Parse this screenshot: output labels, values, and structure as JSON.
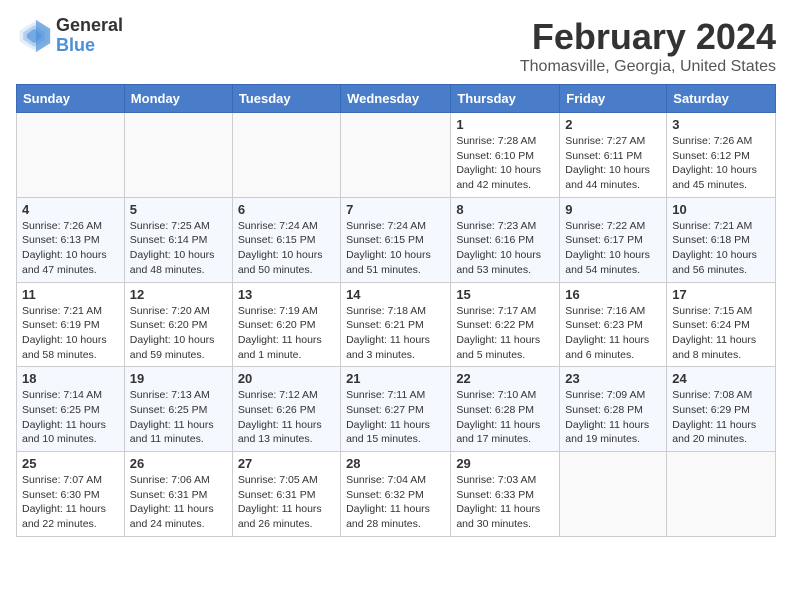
{
  "header": {
    "logo_general": "General",
    "logo_blue": "Blue",
    "month_year": "February 2024",
    "location": "Thomasville, Georgia, United States"
  },
  "days_of_week": [
    "Sunday",
    "Monday",
    "Tuesday",
    "Wednesday",
    "Thursday",
    "Friday",
    "Saturday"
  ],
  "weeks": [
    {
      "days": [
        {
          "num": "",
          "info": ""
        },
        {
          "num": "",
          "info": ""
        },
        {
          "num": "",
          "info": ""
        },
        {
          "num": "",
          "info": ""
        },
        {
          "num": "1",
          "info": "Sunrise: 7:28 AM\nSunset: 6:10 PM\nDaylight: 10 hours\nand 42 minutes."
        },
        {
          "num": "2",
          "info": "Sunrise: 7:27 AM\nSunset: 6:11 PM\nDaylight: 10 hours\nand 44 minutes."
        },
        {
          "num": "3",
          "info": "Sunrise: 7:26 AM\nSunset: 6:12 PM\nDaylight: 10 hours\nand 45 minutes."
        }
      ]
    },
    {
      "days": [
        {
          "num": "4",
          "info": "Sunrise: 7:26 AM\nSunset: 6:13 PM\nDaylight: 10 hours\nand 47 minutes."
        },
        {
          "num": "5",
          "info": "Sunrise: 7:25 AM\nSunset: 6:14 PM\nDaylight: 10 hours\nand 48 minutes."
        },
        {
          "num": "6",
          "info": "Sunrise: 7:24 AM\nSunset: 6:15 PM\nDaylight: 10 hours\nand 50 minutes."
        },
        {
          "num": "7",
          "info": "Sunrise: 7:24 AM\nSunset: 6:15 PM\nDaylight: 10 hours\nand 51 minutes."
        },
        {
          "num": "8",
          "info": "Sunrise: 7:23 AM\nSunset: 6:16 PM\nDaylight: 10 hours\nand 53 minutes."
        },
        {
          "num": "9",
          "info": "Sunrise: 7:22 AM\nSunset: 6:17 PM\nDaylight: 10 hours\nand 54 minutes."
        },
        {
          "num": "10",
          "info": "Sunrise: 7:21 AM\nSunset: 6:18 PM\nDaylight: 10 hours\nand 56 minutes."
        }
      ]
    },
    {
      "days": [
        {
          "num": "11",
          "info": "Sunrise: 7:21 AM\nSunset: 6:19 PM\nDaylight: 10 hours\nand 58 minutes."
        },
        {
          "num": "12",
          "info": "Sunrise: 7:20 AM\nSunset: 6:20 PM\nDaylight: 10 hours\nand 59 minutes."
        },
        {
          "num": "13",
          "info": "Sunrise: 7:19 AM\nSunset: 6:20 PM\nDaylight: 11 hours\nand 1 minute."
        },
        {
          "num": "14",
          "info": "Sunrise: 7:18 AM\nSunset: 6:21 PM\nDaylight: 11 hours\nand 3 minutes."
        },
        {
          "num": "15",
          "info": "Sunrise: 7:17 AM\nSunset: 6:22 PM\nDaylight: 11 hours\nand 5 minutes."
        },
        {
          "num": "16",
          "info": "Sunrise: 7:16 AM\nSunset: 6:23 PM\nDaylight: 11 hours\nand 6 minutes."
        },
        {
          "num": "17",
          "info": "Sunrise: 7:15 AM\nSunset: 6:24 PM\nDaylight: 11 hours\nand 8 minutes."
        }
      ]
    },
    {
      "days": [
        {
          "num": "18",
          "info": "Sunrise: 7:14 AM\nSunset: 6:25 PM\nDaylight: 11 hours\nand 10 minutes."
        },
        {
          "num": "19",
          "info": "Sunrise: 7:13 AM\nSunset: 6:25 PM\nDaylight: 11 hours\nand 11 minutes."
        },
        {
          "num": "20",
          "info": "Sunrise: 7:12 AM\nSunset: 6:26 PM\nDaylight: 11 hours\nand 13 minutes."
        },
        {
          "num": "21",
          "info": "Sunrise: 7:11 AM\nSunset: 6:27 PM\nDaylight: 11 hours\nand 15 minutes."
        },
        {
          "num": "22",
          "info": "Sunrise: 7:10 AM\nSunset: 6:28 PM\nDaylight: 11 hours\nand 17 minutes."
        },
        {
          "num": "23",
          "info": "Sunrise: 7:09 AM\nSunset: 6:28 PM\nDaylight: 11 hours\nand 19 minutes."
        },
        {
          "num": "24",
          "info": "Sunrise: 7:08 AM\nSunset: 6:29 PM\nDaylight: 11 hours\nand 20 minutes."
        }
      ]
    },
    {
      "days": [
        {
          "num": "25",
          "info": "Sunrise: 7:07 AM\nSunset: 6:30 PM\nDaylight: 11 hours\nand 22 minutes."
        },
        {
          "num": "26",
          "info": "Sunrise: 7:06 AM\nSunset: 6:31 PM\nDaylight: 11 hours\nand 24 minutes."
        },
        {
          "num": "27",
          "info": "Sunrise: 7:05 AM\nSunset: 6:31 PM\nDaylight: 11 hours\nand 26 minutes."
        },
        {
          "num": "28",
          "info": "Sunrise: 7:04 AM\nSunset: 6:32 PM\nDaylight: 11 hours\nand 28 minutes."
        },
        {
          "num": "29",
          "info": "Sunrise: 7:03 AM\nSunset: 6:33 PM\nDaylight: 11 hours\nand 30 minutes."
        },
        {
          "num": "",
          "info": ""
        },
        {
          "num": "",
          "info": ""
        }
      ]
    }
  ]
}
